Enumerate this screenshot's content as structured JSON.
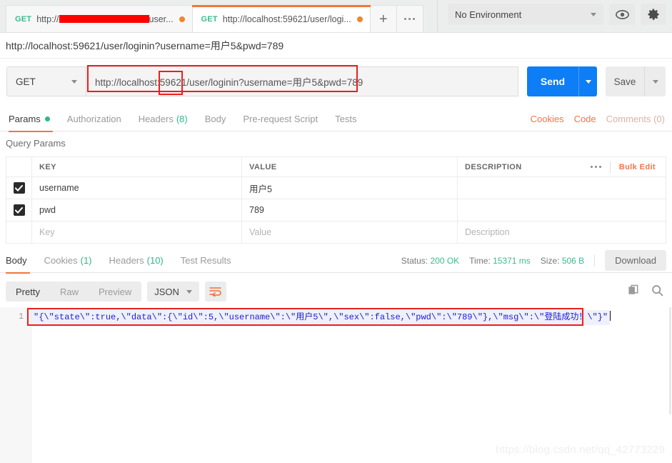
{
  "tabs": [
    {
      "method": "GET",
      "title_prefix": "http://",
      "title_suffix": "user...",
      "redacted": true,
      "unsaved": true,
      "active": false
    },
    {
      "method": "GET",
      "title": "http://localhost:59621/user/logi...",
      "redacted": false,
      "unsaved": true,
      "active": true
    }
  ],
  "tabbar": {
    "new_tab_label": "+",
    "more_label": "•••"
  },
  "environment": {
    "selected": "No Environment",
    "eye_icon": "eye-icon",
    "gear_icon": "gear-icon"
  },
  "url_line": "http://localhost:59621/user/loginin?username=用户5&pwd=789",
  "request": {
    "method": "GET",
    "url": "http://localhost:59621/user/loginin?username=用户5&pwd=789",
    "send_label": "Send",
    "save_label": "Save"
  },
  "request_tabs": [
    {
      "label": "Params",
      "badge": "dot",
      "active": true
    },
    {
      "label": "Authorization",
      "active": false
    },
    {
      "label": "Headers",
      "count": "(8)",
      "active": false
    },
    {
      "label": "Body",
      "active": false
    },
    {
      "label": "Pre-request Script",
      "active": false
    },
    {
      "label": "Tests",
      "active": false
    }
  ],
  "request_tabs_right": [
    {
      "label": "Cookies",
      "dim": false
    },
    {
      "label": "Code",
      "dim": false
    },
    {
      "label": "Comments (0)",
      "dim": true
    }
  ],
  "query_params": {
    "title": "Query Params",
    "columns": [
      "KEY",
      "VALUE",
      "DESCRIPTION"
    ],
    "more_label": "•••",
    "bulk_edit_label": "Bulk Edit",
    "rows": [
      {
        "checked": true,
        "key": "username",
        "value": "用户5",
        "description": ""
      },
      {
        "checked": true,
        "key": "pwd",
        "value": "789",
        "description": ""
      },
      {
        "checked": false,
        "key": "",
        "value": "",
        "description": "",
        "placeholder_key": "Key",
        "placeholder_value": "Value",
        "placeholder_desc": "Description"
      }
    ]
  },
  "response_tabs": [
    {
      "label": "Body",
      "active": true
    },
    {
      "label": "Cookies",
      "count": "(1)",
      "active": false
    },
    {
      "label": "Headers",
      "count": "(10)",
      "active": false
    },
    {
      "label": "Test Results",
      "active": false
    }
  ],
  "response_meta": {
    "status_label": "Status:",
    "status_value": "200 OK",
    "time_label": "Time:",
    "time_value": "15371 ms",
    "size_label": "Size:",
    "size_value": "506 B",
    "download_label": "Download"
  },
  "response_toolbar": {
    "views": [
      {
        "label": "Pretty",
        "active": true
      },
      {
        "label": "Raw",
        "active": false
      },
      {
        "label": "Preview",
        "active": false
      }
    ],
    "format": "JSON",
    "wrap_icon": "word-wrap-icon",
    "copy_icon": "copy-icon",
    "search_icon": "search-icon"
  },
  "response_body": {
    "line_number": "1",
    "text": "\"{\\\"state\\\":true,\\\"data\\\":{\\\"id\\\":5,\\\"username\\\":\\\"用户5\\\",\\\"sex\\\":false,\\\"pwd\\\":\\\"789\\\"},\\\"msg\\\":\\\"登陆成功！\\\"}\""
  },
  "watermark": "https://blog.csdn.net/qq_42773229",
  "colors": {
    "accent_orange": "#f3763a",
    "send_blue": "#0d7ef5",
    "green": "#3cba91",
    "highlight_red": "#ef1d1d",
    "json_blue": "#1c1cd6"
  }
}
